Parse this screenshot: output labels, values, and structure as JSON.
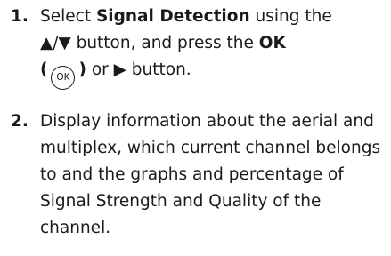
{
  "steps": [
    {
      "number": "1.",
      "text_select": "Select",
      "text_signal_detection": "Signal Detection",
      "text_using_the": "using the",
      "text_arrows": "▲/▼",
      "text_button_and_press_the": "button, and press the",
      "text_ok": "OK",
      "text_open_paren": "(",
      "ok_icon_label": "OK",
      "text_close_paren": ")",
      "text_or": "or",
      "text_play_arrow": "▶",
      "text_button_end": "button."
    },
    {
      "number": "2.",
      "text": "Display information about the aerial and multiplex, which current channel belongs to and the graphs and percentage of Signal Strength and Quality of the channel."
    }
  ]
}
